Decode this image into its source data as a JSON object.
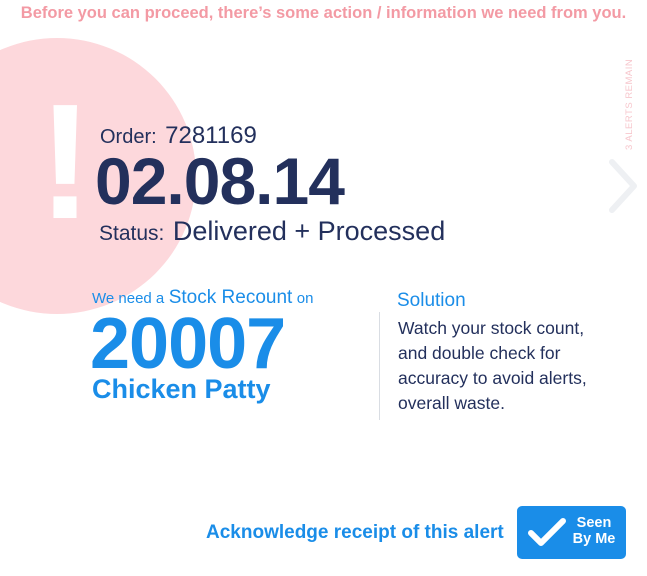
{
  "banner": {
    "text": "Before you can proceed, there’s some action / information we need from you."
  },
  "alert": {
    "icon": "exclamation-icon",
    "glyph": "!",
    "remaining_text": "3 ALERTS REMAIN",
    "next_icon": "chevron-right-icon"
  },
  "order": {
    "label": "Order:",
    "number": "7281169",
    "date": "02.08.14",
    "status_label": "Status:",
    "status_value": "Delivered + Processed"
  },
  "request": {
    "prefix": "We need a",
    "action": "Stock Recount",
    "suffix": "on",
    "item_number": "20007",
    "item_name": "Chicken Patty"
  },
  "solution": {
    "title": "Solution",
    "text": "Watch your stock count, and double check for accuracy to avoid alerts, overall waste."
  },
  "acknowledge": {
    "text": "Acknowledge receipt of this alert",
    "button_line1": "Seen",
    "button_line2": "By Me",
    "button_icon": "checkmark-icon"
  },
  "colors": {
    "navy": "#23305c",
    "blue": "#1a8de8",
    "pink": "#f39aa4",
    "pink_light": "#fdd8dc"
  }
}
